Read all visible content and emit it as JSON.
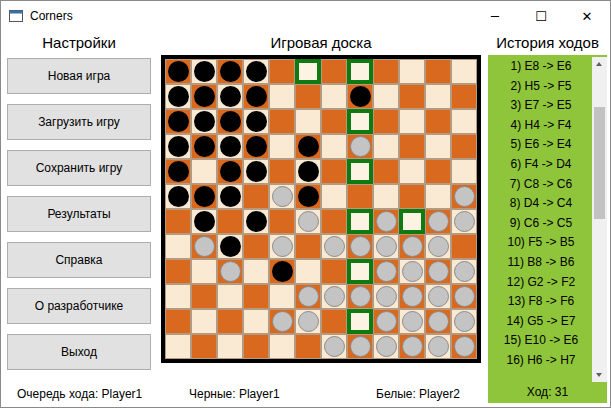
{
  "window": {
    "title": "Corners",
    "controls": [
      "─",
      "☐",
      "✕"
    ]
  },
  "settings": {
    "title": "Настройки",
    "buttons": [
      "Новая игра",
      "Загрузить игру",
      "Сохранить игру",
      "Результаты",
      "Справка",
      "О разработчике",
      "Выход"
    ]
  },
  "board": {
    "title": "Игровая доска",
    "rows": [
      "bbbb.m.m....",
      "bbbb...b....",
      "bbbb...m....",
      "bbbb.b.w....",
      "b.bb.b.m....",
      "bbb.wb.....w",
      ".b.b.w.mwmww",
      ".wb.w.wwwww.",
      "..w.b..mwwww",
      ".....wwwwwww",
      "....ww.mwwww",
      "......wwwwww"
    ]
  },
  "history": {
    "title": "История ходов",
    "moves": [
      "1) E8 -> E6",
      "2) H5 -> F5",
      "3) E7 -> E5",
      "4) H4 -> F4",
      "5) E6 -> E4",
      "6) F4 -> D4",
      "7) C8 -> C6",
      "8) D4 -> C4",
      "9) C6 -> C5",
      "10) F5 -> B5",
      "11) B8 -> B6",
      "12) G2 -> F2",
      "13) F8 -> F6",
      "14) G5 -> E7",
      "15) E10 -> E6",
      "16) H6 -> H7"
    ],
    "scrollbar": {
      "offset": 0.12,
      "size": 0.38
    },
    "move_counter": "Ход: 31"
  },
  "status_bar": {
    "turn": "Очередь хода: Player1",
    "black": "Черные: Player1",
    "white": "Белые: Player2"
  }
}
